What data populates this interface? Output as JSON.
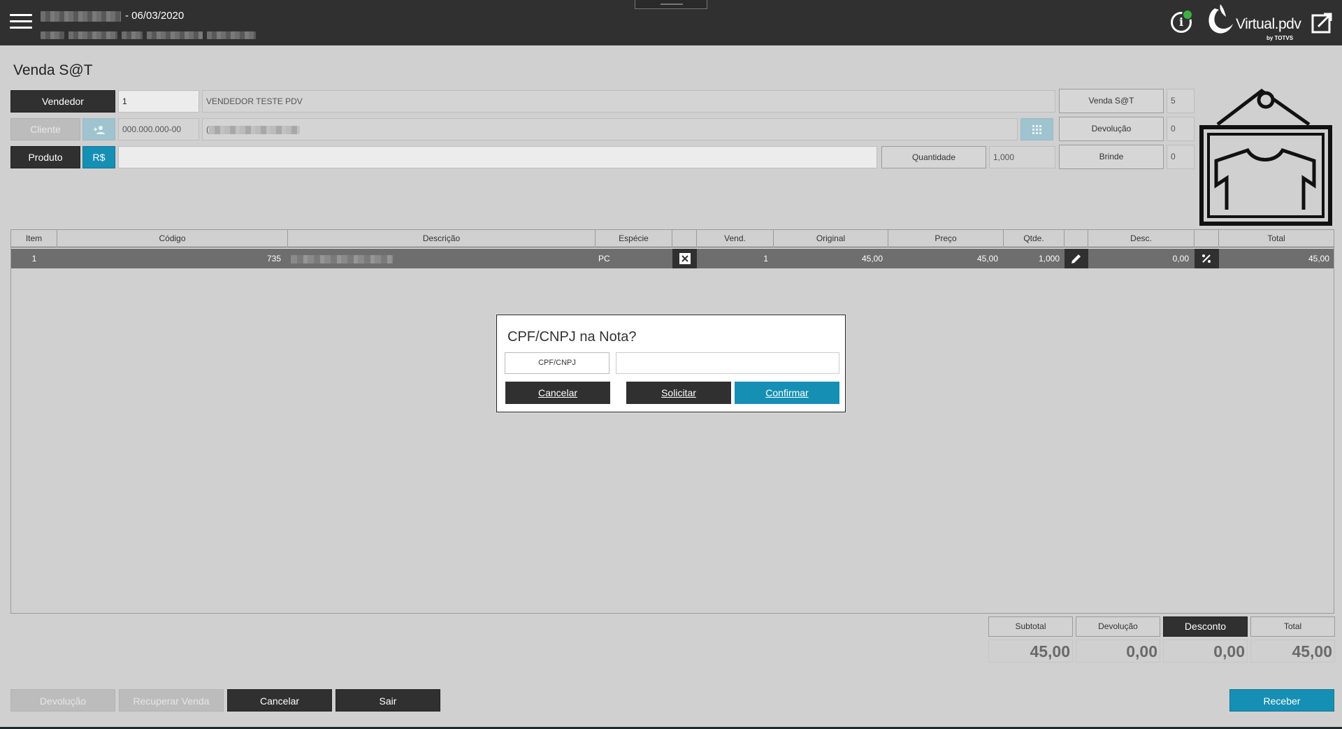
{
  "topbar": {
    "date": "- 06/03/2020",
    "logo_text": "Virtual.pdv",
    "logo_by": "by TOTVS"
  },
  "page_title": "Venda S@T",
  "form": {
    "vendedor_label": "Vendedor",
    "vendedor_code": "1",
    "vendedor_name": "VENDEDOR TESTE PDV",
    "cliente_label": "Cliente",
    "cliente_doc": "000.000.000-00",
    "cliente_name_prefix": "(",
    "produto_label": "Produto",
    "currency_label": "R$",
    "produto_value": "",
    "quantidade_label": "Quantidade",
    "quantidade_value": "1,000",
    "side": [
      {
        "label": "Venda S@T",
        "value": "5"
      },
      {
        "label": "Devolução",
        "value": "0"
      },
      {
        "label": "Brinde",
        "value": "0"
      }
    ]
  },
  "table": {
    "headers": [
      "Item",
      "Código",
      "Descrição",
      "Espécie",
      "",
      "Vend.",
      "Original",
      "Preço",
      "Qtde.",
      "",
      "Desc.",
      "",
      "Total"
    ],
    "rows": [
      {
        "item": "1",
        "codigo": "735",
        "descricao": "",
        "especie": "PC",
        "vend": "1",
        "original": "45,00",
        "preco": "45,00",
        "qtde": "1,000",
        "desc": "0,00",
        "total": "45,00"
      }
    ]
  },
  "modal": {
    "title": "CPF/CNPJ na Nota?",
    "field_label": "CPF/CNPJ",
    "input_value": "",
    "cancel_label": "Cancelar",
    "request_label": "Solicitar",
    "confirm_label": "Confirmar"
  },
  "totals": [
    {
      "label": "Subtotal",
      "value": "45,00"
    },
    {
      "label": "Devolução",
      "value": "0,00"
    },
    {
      "label": "Desconto",
      "value": "0,00"
    },
    {
      "label": "Total",
      "value": "45,00"
    }
  ],
  "bottom": {
    "devolucao_label": "Devolução",
    "recuperar_label": "Recuperar Venda",
    "cancelar_label": "Cancelar",
    "sair_label": "Sair",
    "receber_label": "Receber"
  },
  "colors": {
    "topbar": "#303030",
    "accent_blue": "#168fb4",
    "status_green": "#3cb043",
    "dark_button": "#303030"
  }
}
